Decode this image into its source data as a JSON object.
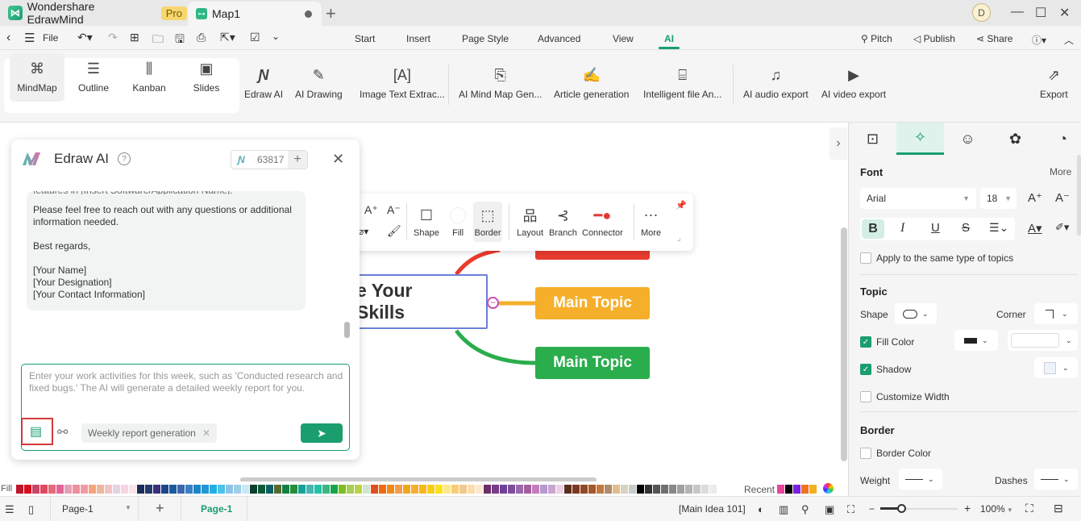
{
  "titlebar": {
    "app_name": "Wondershare EdrawMind",
    "pro_badge": "Pro",
    "doc_tab": "Map1",
    "user_initial": "D"
  },
  "menubar": {
    "file_label": "File",
    "tabs": [
      "Start",
      "Insert",
      "Page Style",
      "Advanced",
      "View",
      "AI"
    ],
    "active_tab": "AI",
    "right_actions": [
      "Pitch",
      "Publish",
      "Share"
    ]
  },
  "ribbon": {
    "views": [
      "MindMap",
      "Outline",
      "Kanban",
      "Slides"
    ],
    "selected_view": "MindMap",
    "ai_tools": [
      "Edraw AI",
      "AI Drawing",
      "Image Text Extrac...",
      "AI Mind Map Gen...",
      "Article generation",
      "Intelligent file An...",
      "AI audio export",
      "AI video export"
    ],
    "export_label": "Export"
  },
  "ai_panel": {
    "title": "Edraw AI",
    "credits": "63817",
    "message_lines": [
      "Please feel free to reach out with any questions or additional information needed.",
      "Best regards,",
      "[Your Name]",
      "[Your Designation]",
      "[Your Contact Information]"
    ],
    "input_placeholder": "Enter your work activities for this week, such as 'Conducted research and fixed bugs.' The AI will generate a detailed weekly report for you.",
    "chip_label": "Weekly report generation"
  },
  "floating_toolbar": {
    "items": [
      "Shape",
      "Fill",
      "Border",
      "Layout",
      "Branch",
      "Connector",
      "More"
    ]
  },
  "mindmap": {
    "central_topic": "e Your Skills",
    "topics": [
      {
        "label": "Main Topic",
        "color": "#f5af2b"
      },
      {
        "label": "Main Topic",
        "color": "#2aad4c"
      }
    ],
    "partial_topic_color": "#ea3b2f"
  },
  "right_panel": {
    "font_section": "Font",
    "more_label": "More",
    "font_family": "Arial",
    "font_size": "18",
    "apply_same_label": "Apply to the same type of topics",
    "topic_section": "Topic",
    "shape_label": "Shape",
    "corner_label": "Corner",
    "fill_color_label": "Fill Color",
    "fill_color_checked": true,
    "shadow_label": "Shadow",
    "shadow_checked": true,
    "customize_width_label": "Customize Width",
    "border_section": "Border",
    "border_color_label": "Border Color",
    "weight_label": "Weight",
    "dashes_label": "Dashes"
  },
  "palette": {
    "fill_label": "Fill",
    "recent_label": "Recent",
    "colors": [
      "#c0162c",
      "#d4111e",
      "#c94468",
      "#df4a5f",
      "#e56a78",
      "#e26494",
      "#e6a0b8",
      "#ed8f9e",
      "#f09aa8",
      "#f4a57e",
      "#f0b49f",
      "#f2c4c4",
      "#e4d3e3",
      "#f7d6e2",
      "#fbe3ea",
      "#1c2b5a",
      "#24396c",
      "#3a2f7a",
      "#19478a",
      "#1d5a9e",
      "#3a66b0",
      "#3b7fc3",
      "#1786c9",
      "#2297d3",
      "#22b0e4",
      "#4bc2e8",
      "#8cc4e6",
      "#9ccfe6",
      "#cde7f3",
      "#0e3f2e",
      "#0f5a36",
      "#0c6067",
      "#556b2f",
      "#157f43",
      "#248f3b",
      "#17a199",
      "#4ab4b1",
      "#21c2a8",
      "#3bb583",
      "#17a54b",
      "#7ebd23",
      "#a8cd5a",
      "#bad24a",
      "#d1e5cd",
      "#e24d1d",
      "#ed6b12",
      "#f28818",
      "#f39c4d",
      "#f1a71c",
      "#f6ad33",
      "#f6b81b",
      "#f8cd19",
      "#fbe11b",
      "#fbe98a",
      "#f9cc78",
      "#efc98d",
      "#fbdcae",
      "#fbe8d0",
      "#6b2f6b",
      "#7a3b87",
      "#6d4197",
      "#7c4d9b",
      "#9a68ad",
      "#a25e9c",
      "#c77cb9",
      "#b59ad0",
      "#c8a6cf",
      "#ead0e2",
      "#5a2d1e",
      "#7a3a22",
      "#8e4a25",
      "#a5582a",
      "#c07a3d",
      "#b08a6c",
      "#e2bc8a",
      "#d6d2c4",
      "#c8ccc8",
      "#000000",
      "#333333",
      "#555555",
      "#707070",
      "#888888",
      "#a0a0a0",
      "#b4b4b4",
      "#c8c8c8",
      "#dcdcdc",
      "#ececec"
    ],
    "recent_colors": [
      "#e8449a",
      "#000000",
      "#7b1fe0",
      "#f2711c",
      "#f2b123"
    ]
  },
  "statusbar": {
    "page_select": "Page-1",
    "active_page": "Page-1",
    "selection_info": "[Main Idea 101]",
    "zoom_level": "100%",
    "zoom_fraction": 0.27
  }
}
